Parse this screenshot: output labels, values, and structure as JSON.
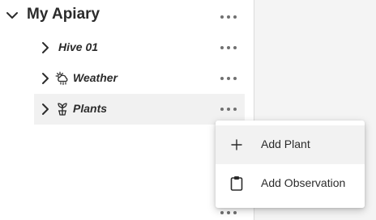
{
  "tree": {
    "root": {
      "label": "My Apiary",
      "icon": "chevron-down-icon"
    },
    "children": [
      {
        "label": "Hive 01",
        "icon": "chevron-right-icon",
        "node_icon": null
      },
      {
        "label": "Weather",
        "icon": "chevron-right-icon",
        "node_icon": "weather-icon"
      },
      {
        "label": "Plants",
        "icon": "chevron-right-icon",
        "node_icon": "plant-icon",
        "selected": true
      }
    ],
    "more_icon": "more-horizontal-icon"
  },
  "context_menu": {
    "items": [
      {
        "label": "Add Plant",
        "icon": "plus-icon"
      },
      {
        "label": "Add Observation",
        "icon": "clipboard-icon"
      }
    ]
  },
  "colors": {
    "selected_row_bg": "#f1f1f1",
    "side_panel_bg": "#f4f4f4",
    "text": "#2b2b2b",
    "icon": "#707070"
  }
}
